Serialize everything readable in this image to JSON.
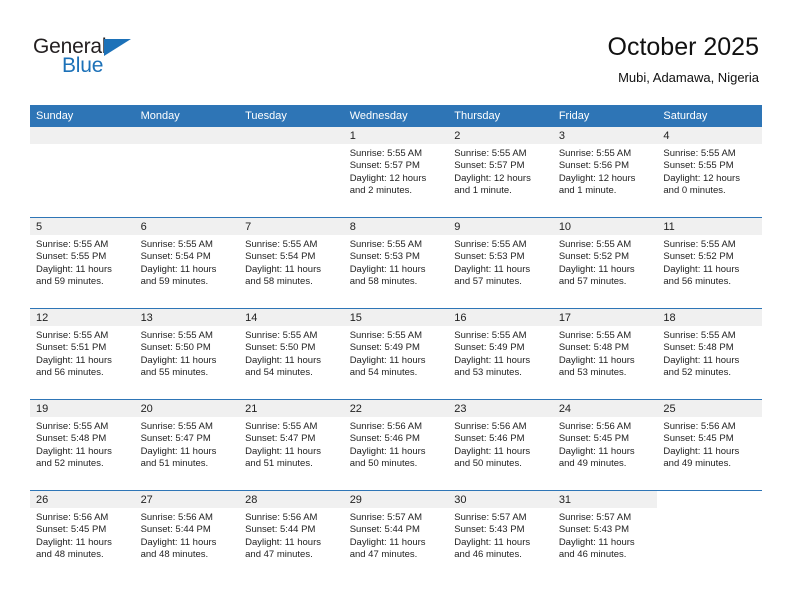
{
  "brand": {
    "name_top": "General",
    "name_bottom": "Blue"
  },
  "header": {
    "title": "October 2025",
    "location": "Mubi, Adamawa, Nigeria"
  },
  "colors": {
    "header_blue": "#2e75b6",
    "brand_blue": "#1c71b8",
    "day_band": "#f0f0f0"
  },
  "weekday_headers": [
    "Sunday",
    "Monday",
    "Tuesday",
    "Wednesday",
    "Thursday",
    "Friday",
    "Saturday"
  ],
  "labels": {
    "sunrise_prefix": "Sunrise:",
    "sunset_prefix": "Sunset:",
    "daylight_prefix": "Daylight:"
  },
  "weeks": [
    [
      {
        "day": "",
        "sunrise": "",
        "sunset": "",
        "daylight_line1": "",
        "daylight_line2": "",
        "empty": true
      },
      {
        "day": "",
        "sunrise": "",
        "sunset": "",
        "daylight_line1": "",
        "daylight_line2": "",
        "empty": true
      },
      {
        "day": "",
        "sunrise": "",
        "sunset": "",
        "daylight_line1": "",
        "daylight_line2": "",
        "empty": true
      },
      {
        "day": "1",
        "sunrise": "Sunrise: 5:55 AM",
        "sunset": "Sunset: 5:57 PM",
        "daylight_line1": "Daylight: 12 hours",
        "daylight_line2": "and 2 minutes."
      },
      {
        "day": "2",
        "sunrise": "Sunrise: 5:55 AM",
        "sunset": "Sunset: 5:57 PM",
        "daylight_line1": "Daylight: 12 hours",
        "daylight_line2": "and 1 minute."
      },
      {
        "day": "3",
        "sunrise": "Sunrise: 5:55 AM",
        "sunset": "Sunset: 5:56 PM",
        "daylight_line1": "Daylight: 12 hours",
        "daylight_line2": "and 1 minute."
      },
      {
        "day": "4",
        "sunrise": "Sunrise: 5:55 AM",
        "sunset": "Sunset: 5:55 PM",
        "daylight_line1": "Daylight: 12 hours",
        "daylight_line2": "and 0 minutes."
      }
    ],
    [
      {
        "day": "5",
        "sunrise": "Sunrise: 5:55 AM",
        "sunset": "Sunset: 5:55 PM",
        "daylight_line1": "Daylight: 11 hours",
        "daylight_line2": "and 59 minutes."
      },
      {
        "day": "6",
        "sunrise": "Sunrise: 5:55 AM",
        "sunset": "Sunset: 5:54 PM",
        "daylight_line1": "Daylight: 11 hours",
        "daylight_line2": "and 59 minutes."
      },
      {
        "day": "7",
        "sunrise": "Sunrise: 5:55 AM",
        "sunset": "Sunset: 5:54 PM",
        "daylight_line1": "Daylight: 11 hours",
        "daylight_line2": "and 58 minutes."
      },
      {
        "day": "8",
        "sunrise": "Sunrise: 5:55 AM",
        "sunset": "Sunset: 5:53 PM",
        "daylight_line1": "Daylight: 11 hours",
        "daylight_line2": "and 58 minutes."
      },
      {
        "day": "9",
        "sunrise": "Sunrise: 5:55 AM",
        "sunset": "Sunset: 5:53 PM",
        "daylight_line1": "Daylight: 11 hours",
        "daylight_line2": "and 57 minutes."
      },
      {
        "day": "10",
        "sunrise": "Sunrise: 5:55 AM",
        "sunset": "Sunset: 5:52 PM",
        "daylight_line1": "Daylight: 11 hours",
        "daylight_line2": "and 57 minutes."
      },
      {
        "day": "11",
        "sunrise": "Sunrise: 5:55 AM",
        "sunset": "Sunset: 5:52 PM",
        "daylight_line1": "Daylight: 11 hours",
        "daylight_line2": "and 56 minutes."
      }
    ],
    [
      {
        "day": "12",
        "sunrise": "Sunrise: 5:55 AM",
        "sunset": "Sunset: 5:51 PM",
        "daylight_line1": "Daylight: 11 hours",
        "daylight_line2": "and 56 minutes."
      },
      {
        "day": "13",
        "sunrise": "Sunrise: 5:55 AM",
        "sunset": "Sunset: 5:50 PM",
        "daylight_line1": "Daylight: 11 hours",
        "daylight_line2": "and 55 minutes."
      },
      {
        "day": "14",
        "sunrise": "Sunrise: 5:55 AM",
        "sunset": "Sunset: 5:50 PM",
        "daylight_line1": "Daylight: 11 hours",
        "daylight_line2": "and 54 minutes."
      },
      {
        "day": "15",
        "sunrise": "Sunrise: 5:55 AM",
        "sunset": "Sunset: 5:49 PM",
        "daylight_line1": "Daylight: 11 hours",
        "daylight_line2": "and 54 minutes."
      },
      {
        "day": "16",
        "sunrise": "Sunrise: 5:55 AM",
        "sunset": "Sunset: 5:49 PM",
        "daylight_line1": "Daylight: 11 hours",
        "daylight_line2": "and 53 minutes."
      },
      {
        "day": "17",
        "sunrise": "Sunrise: 5:55 AM",
        "sunset": "Sunset: 5:48 PM",
        "daylight_line1": "Daylight: 11 hours",
        "daylight_line2": "and 53 minutes."
      },
      {
        "day": "18",
        "sunrise": "Sunrise: 5:55 AM",
        "sunset": "Sunset: 5:48 PM",
        "daylight_line1": "Daylight: 11 hours",
        "daylight_line2": "and 52 minutes."
      }
    ],
    [
      {
        "day": "19",
        "sunrise": "Sunrise: 5:55 AM",
        "sunset": "Sunset: 5:48 PM",
        "daylight_line1": "Daylight: 11 hours",
        "daylight_line2": "and 52 minutes."
      },
      {
        "day": "20",
        "sunrise": "Sunrise: 5:55 AM",
        "sunset": "Sunset: 5:47 PM",
        "daylight_line1": "Daylight: 11 hours",
        "daylight_line2": "and 51 minutes."
      },
      {
        "day": "21",
        "sunrise": "Sunrise: 5:55 AM",
        "sunset": "Sunset: 5:47 PM",
        "daylight_line1": "Daylight: 11 hours",
        "daylight_line2": "and 51 minutes."
      },
      {
        "day": "22",
        "sunrise": "Sunrise: 5:56 AM",
        "sunset": "Sunset: 5:46 PM",
        "daylight_line1": "Daylight: 11 hours",
        "daylight_line2": "and 50 minutes."
      },
      {
        "day": "23",
        "sunrise": "Sunrise: 5:56 AM",
        "sunset": "Sunset: 5:46 PM",
        "daylight_line1": "Daylight: 11 hours",
        "daylight_line2": "and 50 minutes."
      },
      {
        "day": "24",
        "sunrise": "Sunrise: 5:56 AM",
        "sunset": "Sunset: 5:45 PM",
        "daylight_line1": "Daylight: 11 hours",
        "daylight_line2": "and 49 minutes."
      },
      {
        "day": "25",
        "sunrise": "Sunrise: 5:56 AM",
        "sunset": "Sunset: 5:45 PM",
        "daylight_line1": "Daylight: 11 hours",
        "daylight_line2": "and 49 minutes."
      }
    ],
    [
      {
        "day": "26",
        "sunrise": "Sunrise: 5:56 AM",
        "sunset": "Sunset: 5:45 PM",
        "daylight_line1": "Daylight: 11 hours",
        "daylight_line2": "and 48 minutes."
      },
      {
        "day": "27",
        "sunrise": "Sunrise: 5:56 AM",
        "sunset": "Sunset: 5:44 PM",
        "daylight_line1": "Daylight: 11 hours",
        "daylight_line2": "and 48 minutes."
      },
      {
        "day": "28",
        "sunrise": "Sunrise: 5:56 AM",
        "sunset": "Sunset: 5:44 PM",
        "daylight_line1": "Daylight: 11 hours",
        "daylight_line2": "and 47 minutes."
      },
      {
        "day": "29",
        "sunrise": "Sunrise: 5:57 AM",
        "sunset": "Sunset: 5:44 PM",
        "daylight_line1": "Daylight: 11 hours",
        "daylight_line2": "and 47 minutes."
      },
      {
        "day": "30",
        "sunrise": "Sunrise: 5:57 AM",
        "sunset": "Sunset: 5:43 PM",
        "daylight_line1": "Daylight: 11 hours",
        "daylight_line2": "and 46 minutes."
      },
      {
        "day": "31",
        "sunrise": "Sunrise: 5:57 AM",
        "sunset": "Sunset: 5:43 PM",
        "daylight_line1": "Daylight: 11 hours",
        "daylight_line2": "and 46 minutes."
      },
      {
        "day": "",
        "sunrise": "",
        "sunset": "",
        "daylight_line1": "",
        "daylight_line2": "",
        "blank": true
      }
    ]
  ]
}
